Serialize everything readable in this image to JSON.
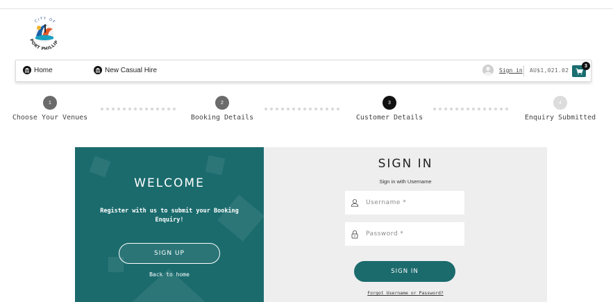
{
  "nav": {
    "home_label": "Home",
    "casual_label": "New Casual Hire",
    "sign_in_label": "Sign in",
    "total": "AU$1,021.02",
    "cart_count": "3"
  },
  "steps": [
    {
      "number": "1",
      "label": "Choose Your Venues",
      "color": "#6b6b6b"
    },
    {
      "number": "2",
      "label": "Booking Details",
      "color": "#6b6b6b"
    },
    {
      "number": "3",
      "label": "Customer Details",
      "color": "#111111"
    },
    {
      "number": "4",
      "label": "Enquiry Submitted",
      "color": "#dcdcdc"
    }
  ],
  "welcome": {
    "title": "WELCOME",
    "message": "Register with us to submit your Booking Enquiry!",
    "signup_label": "SIGN UP",
    "back_label": "Back to home"
  },
  "signin": {
    "title": "SIGN IN",
    "subtitle": "Sign in with Username",
    "username_placeholder": "Username *",
    "password_placeholder": "Password *",
    "button_label": "SIGN IN",
    "forgot_label": "Forgot Username or Password?"
  },
  "colors": {
    "brand_teal": "#1b6b6d",
    "panel_grey": "#eeeeee"
  },
  "icons": [
    "city-logo",
    "bank-icon",
    "user-icon",
    "cart-icon",
    "person-icon",
    "lock-icon"
  ]
}
